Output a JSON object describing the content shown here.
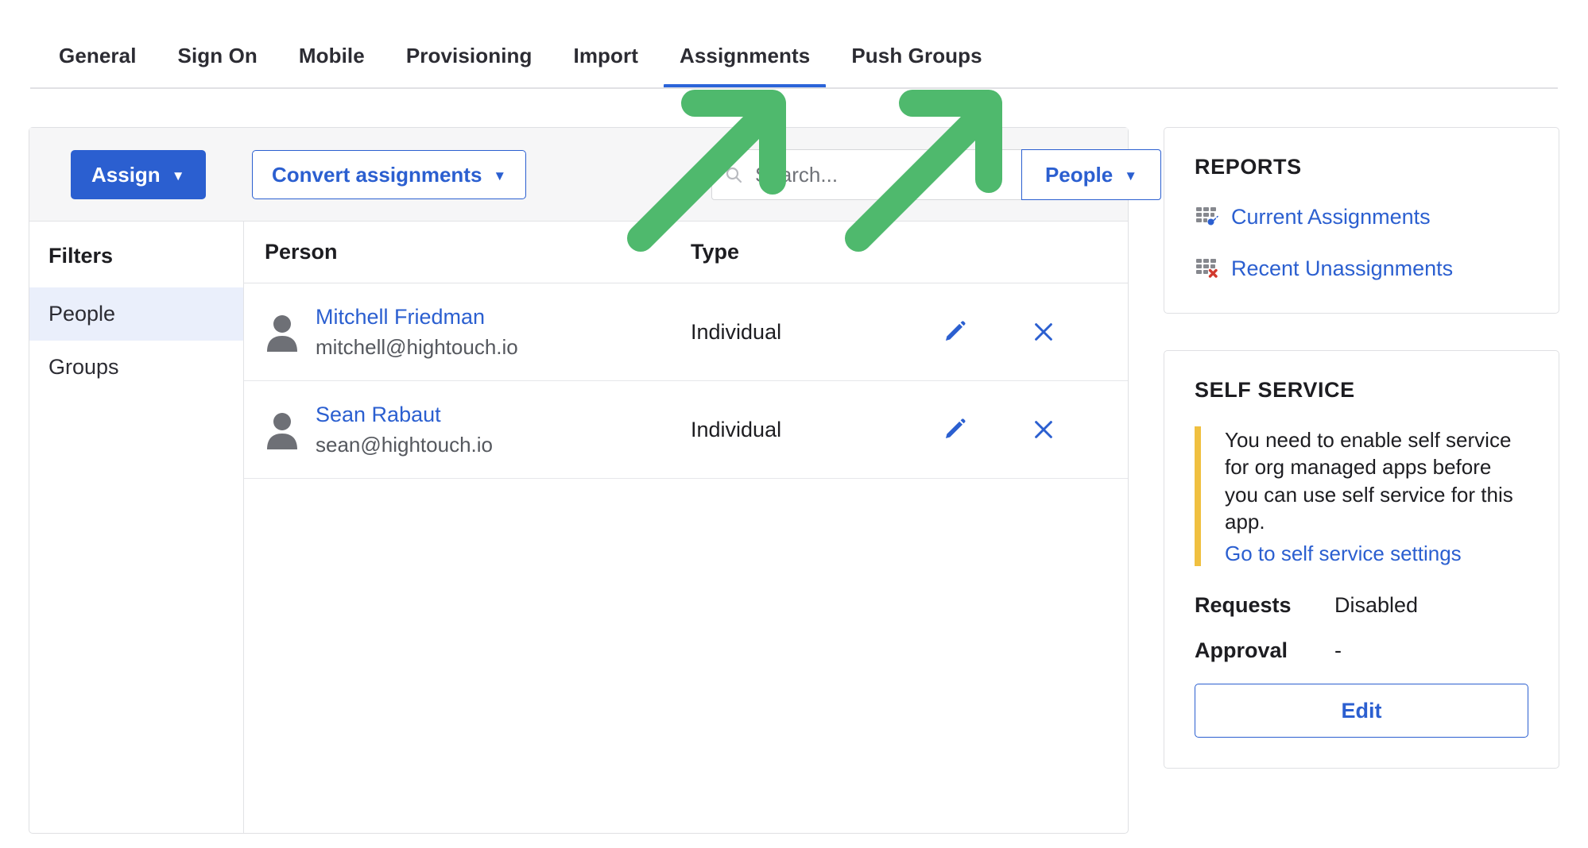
{
  "tabs": [
    {
      "label": "General",
      "active": false
    },
    {
      "label": "Sign On",
      "active": false
    },
    {
      "label": "Mobile",
      "active": false
    },
    {
      "label": "Provisioning",
      "active": false
    },
    {
      "label": "Import",
      "active": false
    },
    {
      "label": "Assignments",
      "active": true
    },
    {
      "label": "Push Groups",
      "active": false
    }
  ],
  "toolbar": {
    "assign_label": "Assign",
    "assign_caret": "▼",
    "convert_label": "Convert assignments",
    "convert_caret": "▼",
    "search_placeholder": "Search...",
    "search_value": "",
    "people_label": "People",
    "people_caret": "▼"
  },
  "filters": {
    "title": "Filters",
    "items": [
      {
        "label": "People",
        "selected": true
      },
      {
        "label": "Groups",
        "selected": false
      }
    ]
  },
  "table": {
    "columns": [
      "Person",
      "Type"
    ],
    "rows": [
      {
        "name": "Mitchell Friedman",
        "email": "mitchell@hightouch.io",
        "type": "Individual",
        "edit_label": "Edit assignment",
        "remove_label": "Remove assignment"
      },
      {
        "name": "Sean Rabaut",
        "email": "sean@hightouch.io",
        "type": "Individual",
        "edit_label": "Edit assignment",
        "remove_label": "Remove assignment"
      }
    ]
  },
  "reports": {
    "title": "REPORTS",
    "links": [
      {
        "label": "Current Assignments",
        "icon": "grid-key-icon"
      },
      {
        "label": "Recent Unassignments",
        "icon": "grid-x-icon"
      }
    ]
  },
  "self_service": {
    "title": "SELF SERVICE",
    "callout_text": "You need to enable self service for org managed apps before you can use self service for this app.",
    "callout_link": "Go to self service settings",
    "requests_key": "Requests",
    "requests_value": "Disabled",
    "approval_key": "Approval",
    "approval_value": "-",
    "edit_label": "Edit"
  },
  "annotations": {
    "arrow_color": "#4fb96d",
    "arrows": [
      {
        "name": "arrow-to-search-field"
      },
      {
        "name": "arrow-to-people-filter"
      }
    ]
  },
  "colors": {
    "accent_blue": "#2b5fd0",
    "tab_underline": "#2b64d9",
    "warning_yellow": "#f0c040",
    "annotation_green": "#4fb96d",
    "selected_row": "#eaeffb"
  }
}
